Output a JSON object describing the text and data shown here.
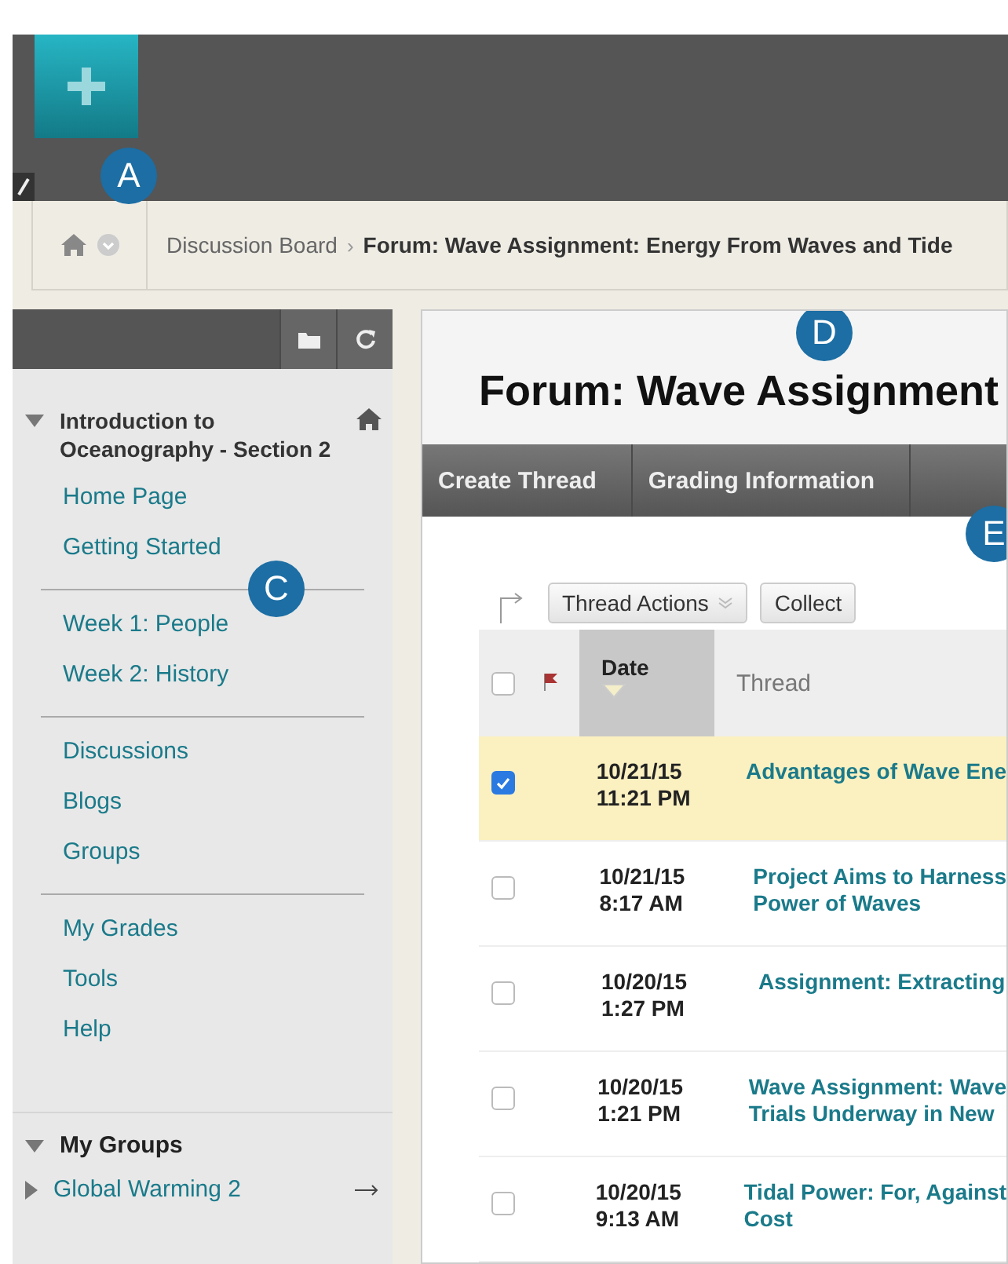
{
  "callouts": [
    {
      "label": "A"
    },
    {
      "label": "C"
    },
    {
      "label": "D"
    },
    {
      "label": "E"
    }
  ],
  "breadcrumb": {
    "separator": "›",
    "items": [
      {
        "label": "Discussion Board",
        "current": false
      },
      {
        "label": "Forum: Wave Assignment: Energy From Waves and Tide",
        "current": true
      }
    ]
  },
  "sidebar": {
    "course": {
      "title": "Introduction to Oceanography - Section 2",
      "expanded": true
    },
    "groups": [
      {
        "items": [
          "Home Page",
          "Getting Started"
        ]
      },
      {
        "items": [
          "Week 1: People",
          "Week 2: History"
        ]
      },
      {
        "items": [
          "Discussions",
          "Blogs",
          "Groups"
        ]
      },
      {
        "items": [
          "My Grades",
          "Tools",
          "Help"
        ]
      }
    ],
    "my_groups": {
      "title": "My Groups",
      "expanded": true,
      "items": [
        {
          "label": "Global Warming 2",
          "expanded": false
        }
      ]
    }
  },
  "page_title": "Forum: Wave Assignment",
  "action_bar": [
    "Create Thread",
    "Grading Information"
  ],
  "toolbar": {
    "buttons": [
      {
        "label": "Thread Actions",
        "kind": "menu"
      },
      {
        "label": "Collect",
        "kind": "plain"
      }
    ]
  },
  "table": {
    "select_all_checked": false,
    "columns": [
      "Date",
      "Thread"
    ],
    "rows": [
      {
        "date": "10/21/15",
        "time": "11:21 PM",
        "thread": "Advantages of Wave Ene",
        "selected": true
      },
      {
        "date": "10/21/15",
        "time": "8:17 AM",
        "thread": "Project Aims to Harness\nPower of Waves",
        "selected": false
      },
      {
        "date": "10/20/15",
        "time": "1:27 PM",
        "thread": "Assignment: Extracting",
        "selected": false
      },
      {
        "date": "10/20/15",
        "time": "1:21 PM",
        "thread": "Wave Assignment: Wave\nTrials Underway in New",
        "selected": false
      },
      {
        "date": "10/20/15",
        "time": "9:13 AM",
        "thread": "Tidal Power: For, Against\nCost",
        "selected": false
      }
    ]
  }
}
